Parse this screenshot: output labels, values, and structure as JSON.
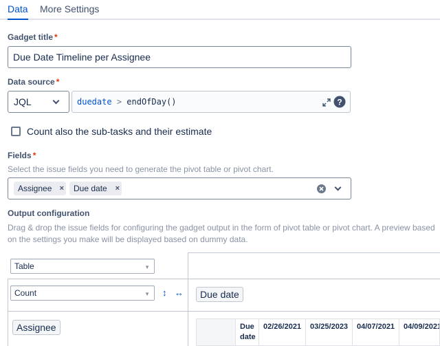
{
  "tabs": [
    {
      "label": "Data",
      "active": true
    },
    {
      "label": "More Settings",
      "active": false
    }
  ],
  "gadget_title": {
    "label": "Gadget title",
    "required_marker": "*",
    "value": "Due Date Timeline per Assignee"
  },
  "data_source": {
    "label": "Data source",
    "required_marker": "*",
    "type_select": "JQL",
    "jql": {
      "field": "duedate",
      "operator": ">",
      "function": "endOfDay()"
    }
  },
  "subtasks_checkbox": {
    "label": "Count also the sub-tasks and their estimate",
    "checked": false
  },
  "fields": {
    "label": "Fields",
    "required_marker": "*",
    "help": "Select the issue fields you need to generate the pivot table or pivot chart.",
    "tags": [
      "Assignee",
      "Due date"
    ],
    "remove_glyph": "×"
  },
  "output": {
    "label": "Output configuration",
    "help": "Drag & drop the issue fields for configuring the gadget output in the form of pivot table or pivot chart. A preview based on the settings you make will be displayed based on dummy data.",
    "view_select": "Table",
    "measure_select": "Count",
    "sort_icon": "↕",
    "swap_icon": "↔",
    "column_field": "Due date",
    "row_field": "Assignee",
    "preview": {
      "header_first": "Due date",
      "columns": [
        "02/26/2021",
        "03/25/2023",
        "04/07/2021",
        "04/09/2021"
      ]
    }
  },
  "colors": {
    "accent": "#0052cc",
    "required": "#de350b",
    "border": "#7a869a"
  }
}
